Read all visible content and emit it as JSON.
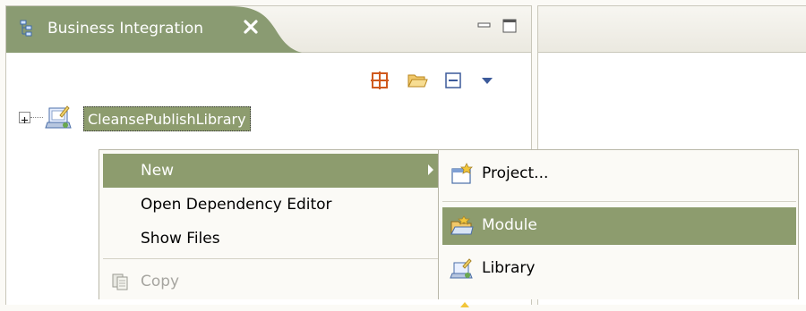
{
  "left_view": {
    "tab_title": "Business Integration",
    "toolbar": [
      "grid-icon",
      "open-folder-icon",
      "collapse-all-icon",
      "view-menu-icon"
    ]
  },
  "tree": {
    "items": [
      {
        "label": "CleansePublishLibrary",
        "icon": "library-icon",
        "expanded": false,
        "selected": true
      }
    ]
  },
  "context_menu": {
    "items": [
      {
        "label": "New",
        "highlighted": true,
        "has_submenu": true
      },
      {
        "label": "Open Dependency Editor"
      },
      {
        "label": "Show Files"
      },
      {
        "label": "Copy",
        "disabled": true,
        "icon": "copy-icon"
      }
    ]
  },
  "submenu": {
    "items": [
      {
        "label": "Project...",
        "icon": "new-project-icon"
      },
      {
        "label": "Module",
        "icon": "module-icon",
        "highlighted": true
      },
      {
        "label": "Library",
        "icon": "library-icon"
      }
    ]
  },
  "colors": {
    "selection": "#8d9c6e",
    "active_tab": "#8a9b72",
    "panel_border": "#c9c7ba"
  }
}
